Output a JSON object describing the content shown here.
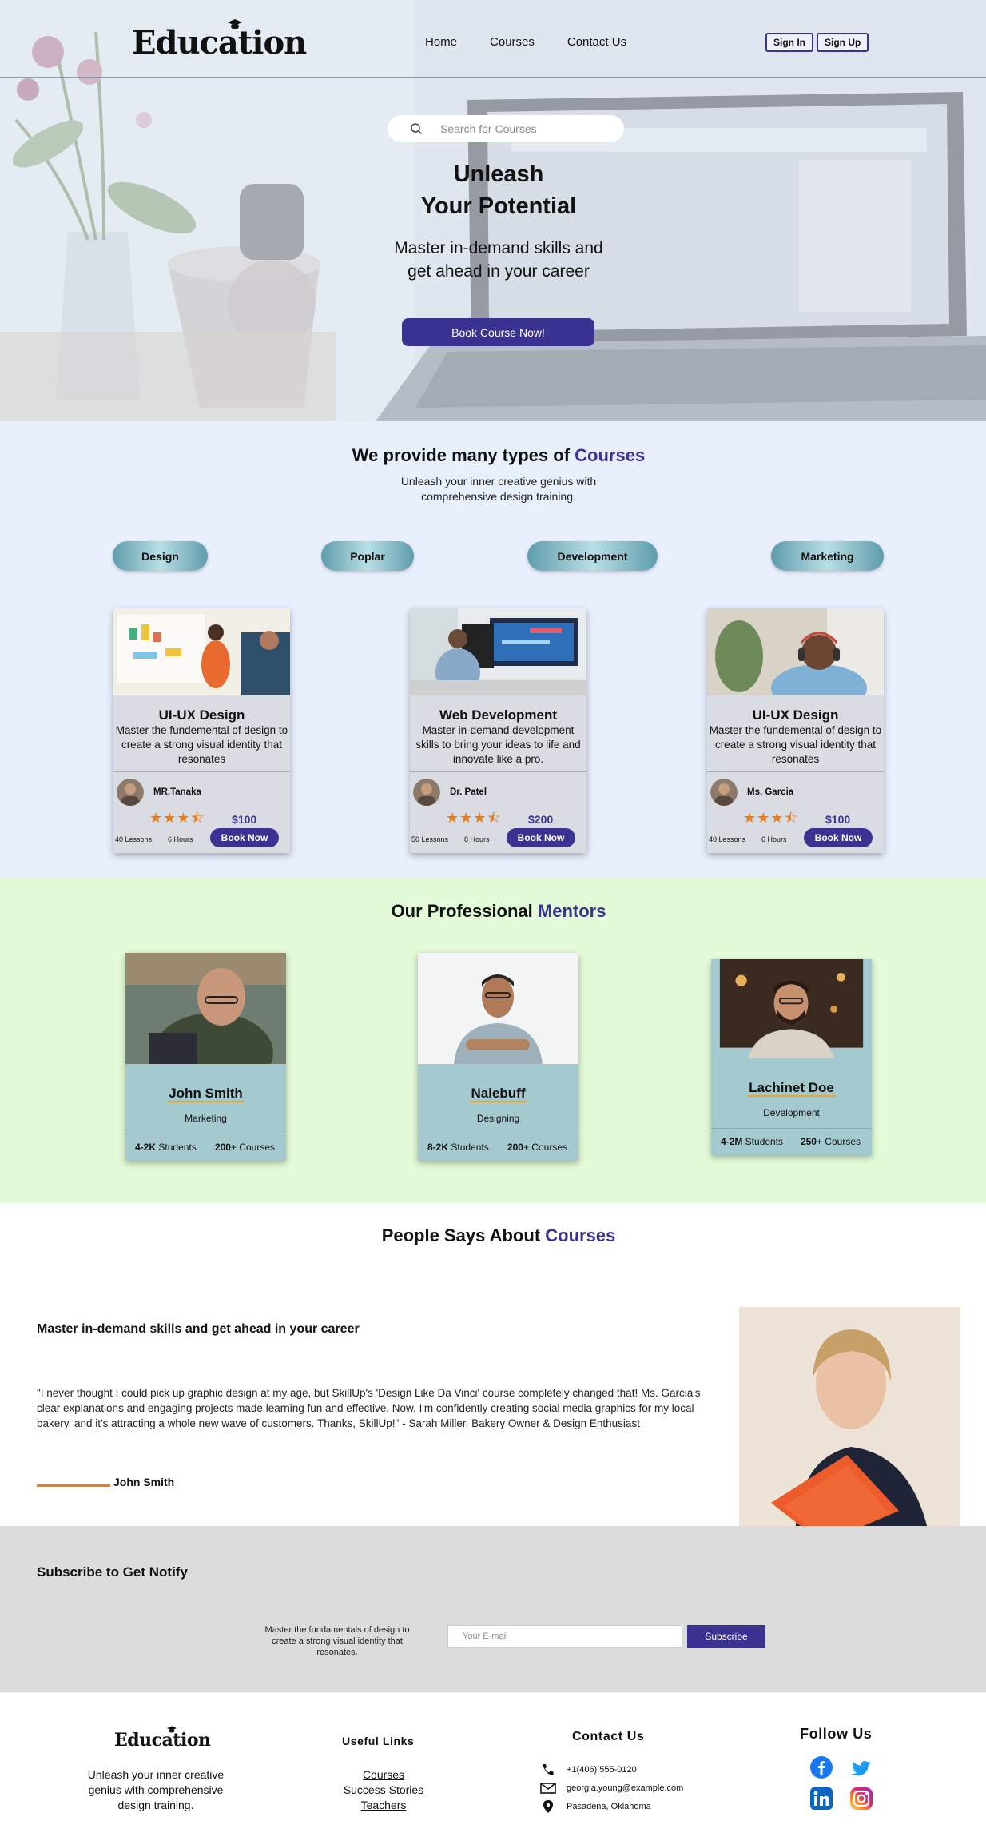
{
  "nav": {
    "logo": "Education",
    "links": [
      "Home",
      "Courses",
      "Contact Us"
    ],
    "sign_in": "Sign In",
    "sign_up": "Sign Up"
  },
  "hero": {
    "search_placeholder": "Search for Courses",
    "title_line1": "Unleash",
    "title_line2": "Your Potential",
    "subtitle_line1": "Master in-demand skills and",
    "subtitle_line2": "get ahead in your career",
    "cta": "Book Course Now!"
  },
  "courses": {
    "title_prefix": "We provide many types of ",
    "title_accent": "Courses",
    "subtitle_line1": "Unleash your inner creative genius with",
    "subtitle_line2": "comprehensive design training.",
    "categories": [
      "Design",
      "Poplar",
      "Development",
      "Marketing"
    ],
    "cards": [
      {
        "title": "UI-UX Design",
        "desc": "Master the fundemental of design to create a strong visual identity that resonates",
        "mentor": "MR.Tanaka",
        "rating": 3.5,
        "price": "$100",
        "lessons": "40 Lessons",
        "hours": "6 Hours",
        "book": "Book Now"
      },
      {
        "title": "Web Development",
        "desc": "Master in-demand development skills to bring your ideas to life and innovate like a pro.",
        "mentor": "Dr. Patel",
        "rating": 3.5,
        "price": "$200",
        "lessons": "50 Lessons",
        "hours": "8 Hours",
        "book": "Book Now"
      },
      {
        "title": "UI-UX Design",
        "desc": "Master the fundemental of design to create a strong visual identity that resonates",
        "mentor": "Ms. Garcia",
        "rating": 3.5,
        "price": "$100",
        "lessons": "40 Lessons",
        "hours": "6 Hours",
        "book": "Book Now"
      }
    ]
  },
  "mentors": {
    "title_prefix": "Our Professional ",
    "title_accent": "Mentors",
    "items": [
      {
        "name": "John Smith",
        "role": "Marketing",
        "students_num": "4-2K",
        "students_label": " Students",
        "courses_num": "200",
        "courses_label": "+ Courses"
      },
      {
        "name": "Nalebuff",
        "role": "Designing",
        "students_num": "8-2K",
        "students_label": " Students",
        "courses_num": "200",
        "courses_label": "+ Courses"
      },
      {
        "name": "Lachinet Doe",
        "role": "Development",
        "students_num": "4-2M",
        "students_label": " Students",
        "courses_num": "250",
        "courses_label": "+ Courses"
      }
    ]
  },
  "testimonial": {
    "title_prefix": "People Says About ",
    "title_accent": "Courses",
    "heading": "Master in-demand skills and get ahead in your career",
    "quote": "\"I never thought I could pick up graphic design at my age, but SkillUp's 'Design Like Da Vinci' course completely changed that! Ms. Garcia's clear explanations and engaging projects made learning fun and effective. Now, I'm confidently creating social media graphics for my local bakery, and it's attracting a whole new wave of customers. Thanks, SkillUp!\" - Sarah Miller, Bakery Owner & Design Enthusiast",
    "author": "John Smith"
  },
  "subscribe": {
    "title": "Subscribe to Get Notify",
    "text": "Master the fundamentals of design to create a strong visual identity that resonates.",
    "placeholder": "Your E-mail",
    "button": "Subscribe"
  },
  "footer": {
    "logo": "Education",
    "tagline": "Unleash your inner creative genius with comprehensive design training.",
    "links_title": "Useful Links",
    "links": [
      "Courses",
      "Success Stories",
      "Teachers"
    ],
    "contact_title": "Contact Us",
    "phone": "+1(406) 555-0120",
    "email": "georgia.young@example.com",
    "address": "Pasadena, Oklahoma",
    "follow_title": "Follow Us",
    "socials": [
      "facebook-icon",
      "twitter-icon",
      "linkedin-icon",
      "instagram-icon"
    ]
  },
  "colors": {
    "brand": "#3b3391",
    "star": "#ed7b19",
    "courses_bg": "#e8effd",
    "mentors_bg": "#e3fbd8",
    "subscribe_bg": "#dcdcdc"
  }
}
